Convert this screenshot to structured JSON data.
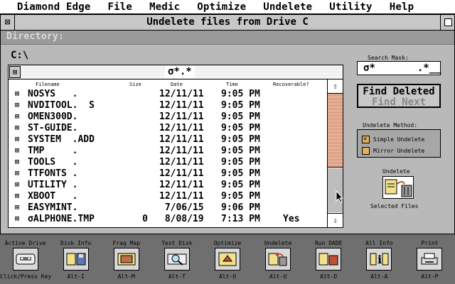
{
  "menu": [
    "Diamond Edge",
    "File",
    "Medic",
    "Optimize",
    "Undelete",
    "Utility",
    "Help"
  ],
  "window": {
    "title": "Undelete files from Drive C",
    "directory_label": "Directory:",
    "path": "C:\\"
  },
  "file_list": {
    "mask": "σ*.*",
    "columns": {
      "filename": "Filename",
      "size": "Size",
      "date": "Date",
      "time": "Time",
      "recoverable": "Recoverable?"
    },
    "rows": [
      {
        "name": "NOSYS   .",
        "size": "",
        "date": "12/11/11",
        "time": "9:05 PM",
        "rec": ""
      },
      {
        "name": "NVDITOOL.  S",
        "size": "",
        "date": "12/11/11",
        "time": "9:05 PM",
        "rec": ""
      },
      {
        "name": "OMEN300D.",
        "size": "",
        "date": "12/11/11",
        "time": "9:05 PM",
        "rec": ""
      },
      {
        "name": "ST-GUIDE.",
        "size": "",
        "date": "12/11/11",
        "time": "9:05 PM",
        "rec": ""
      },
      {
        "name": "SYSTEM  .ADD",
        "size": "",
        "date": "12/11/11",
        "time": "9:05 PM",
        "rec": ""
      },
      {
        "name": "TMP     .",
        "size": "",
        "date": "12/11/11",
        "time": "9:05 PM",
        "rec": ""
      },
      {
        "name": "TOOLS   .",
        "size": "",
        "date": "12/11/11",
        "time": "9:05 PM",
        "rec": ""
      },
      {
        "name": "TTFONTS .",
        "size": "",
        "date": "12/11/11",
        "time": "9:05 PM",
        "rec": ""
      },
      {
        "name": "UTILITY .",
        "size": "",
        "date": "12/11/11",
        "time": "9:05 PM",
        "rec": ""
      },
      {
        "name": "XBOOT   .",
        "size": "",
        "date": "12/11/11",
        "time": "9:05 PM",
        "rec": ""
      },
      {
        "name": "EASYMINT.",
        "size": "",
        "date": " 7/06/15",
        "time": "9:06 PM",
        "rec": ""
      },
      {
        "name": "σALPHONE.TMP",
        "size": "0",
        "date": " 8/08/19",
        "time": "7:13 PM",
        "rec": "Yes"
      }
    ]
  },
  "search": {
    "label": "Search Mask:",
    "value": "σ*       .*__"
  },
  "find": {
    "deleted": "Find Deleted",
    "next": "Find Next"
  },
  "method": {
    "label": "Undelete Method:",
    "options": [
      "Simple Undelete",
      "Mirror Undelete"
    ],
    "selected": 0
  },
  "undelete_action": {
    "label": "Undelete",
    "sub_label": "Selected Files"
  },
  "toolbar": [
    {
      "label": "Active Drive",
      "key": "Click/Press Key",
      "icon": "drive-icon"
    },
    {
      "label": "Disk Info",
      "key": "Alt-I",
      "icon": "disk-info-icon"
    },
    {
      "label": "Frag Map",
      "key": "Alt-M",
      "icon": "frag-map-icon"
    },
    {
      "label": "Test Disk",
      "key": "Alt-T",
      "icon": "test-disk-icon"
    },
    {
      "label": "Optimize",
      "key": "Alt-O",
      "icon": "optimize-icon"
    },
    {
      "label": "Undelete",
      "key": "Alt-U",
      "icon": "undelete-icon"
    },
    {
      "label": "Run DADE",
      "key": "Alt-D",
      "icon": "run-dade-icon"
    },
    {
      "label": "All Info",
      "key": "Alt-A",
      "icon": "all-info-icon"
    },
    {
      "label": "Print",
      "key": "Alt-P",
      "icon": "print-icon"
    }
  ],
  "colors": {
    "desktop": "#6f6f6f",
    "window": "#b9b9b9",
    "scroll_thumb": "#e8a88a",
    "radio_box": "#e0b060"
  }
}
